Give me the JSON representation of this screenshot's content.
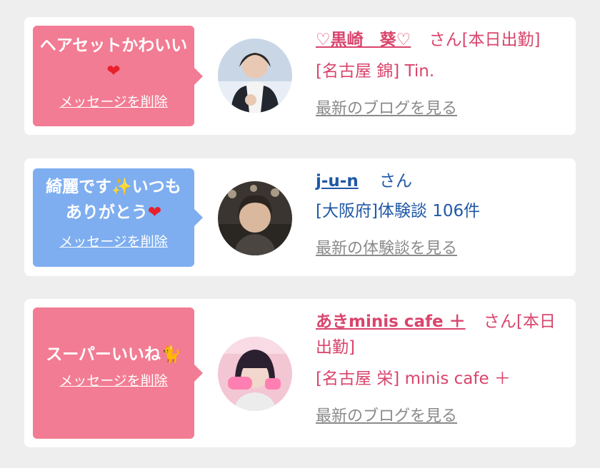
{
  "cards": [
    {
      "bubble_color": "#f27c93",
      "message_text": "ヘアセットかわいい",
      "message_icon": "heart-emoji",
      "delete_label": "メッセージを削除",
      "name": "♡黒崎　葵♡",
      "honorific": "さん",
      "status": "[本日出勤]",
      "area": "[名古屋 錦] Tin.",
      "link_label": "最新のブログを見る",
      "name_color": "#d9456c"
    },
    {
      "bubble_color": "#7eaef0",
      "message_text": "綺麗です✨いつもありがとう",
      "message_icon": "heart-emoji",
      "delete_label": "メッセージを削除",
      "name": "j-u-n",
      "honorific": "さん",
      "area": "[大阪府]体験談 106件",
      "link_label": "最新の体験談を見る",
      "name_color": "#1f58a6"
    },
    {
      "bubble_color": "#f27c93",
      "message_text": "スーパーいいね",
      "message_icon": "black-cat-emoji",
      "delete_label": "メッセージを削除",
      "name": "あきminis cafe ＋",
      "honorific": "さん",
      "status": "[本日出勤]",
      "area": "[名古屋 栄] minis cafe ＋",
      "link_label": "最新のブログを見る",
      "name_color": "#d9456c"
    }
  ]
}
